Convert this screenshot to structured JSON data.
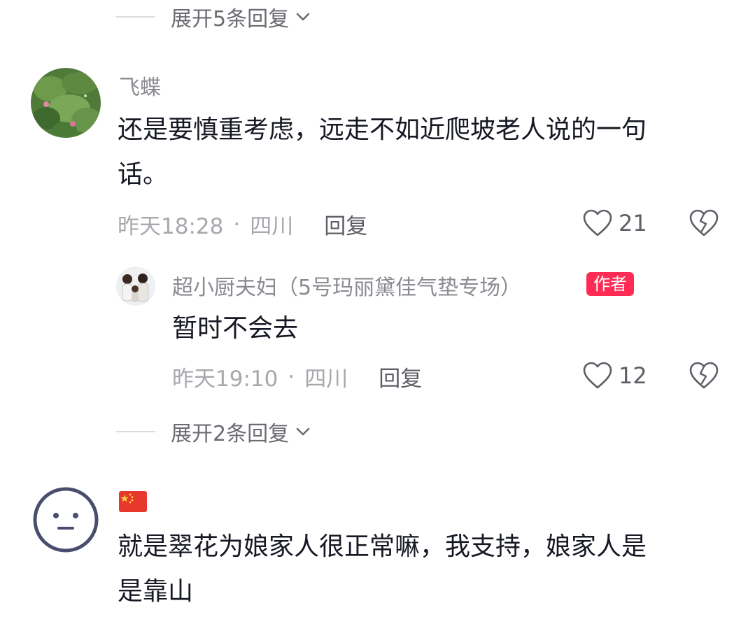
{
  "top_expand": {
    "label": "展开5条回复",
    "chevron_icon": "chevron-down-icon"
  },
  "comment1": {
    "username": "飞蝶",
    "text_line1": "还是要慎重考虑，远走不如近爬坡老人说的一句",
    "text_line2": "话。",
    "time": "昨天18:28",
    "location": "四川",
    "reply_label": "回复",
    "like_count": "21",
    "avatar": "lotus-leaves-photo"
  },
  "reply1": {
    "username": "超小厨夫妇（5号玛丽黛佳气垫专场）",
    "badge": "作者",
    "text": "暂时不会去",
    "time": "昨天19:10",
    "location": "四川",
    "reply_label": "回复",
    "like_count": "12",
    "avatar": "family-photo"
  },
  "mid_expand": {
    "label": "展开2条回复",
    "chevron_icon": "chevron-down-icon"
  },
  "comment2": {
    "username_icon": "china-flag-icon",
    "text_line1": "就是翠花为娘家人很正常嘛，我支持，娘家人是",
    "text_line2": "是靠山",
    "avatar": "neutral-face-icon"
  },
  "meta_separator": "·",
  "colors": {
    "accent": "#fe2c55",
    "muted": "#a7a8ad",
    "text": "#161823"
  }
}
